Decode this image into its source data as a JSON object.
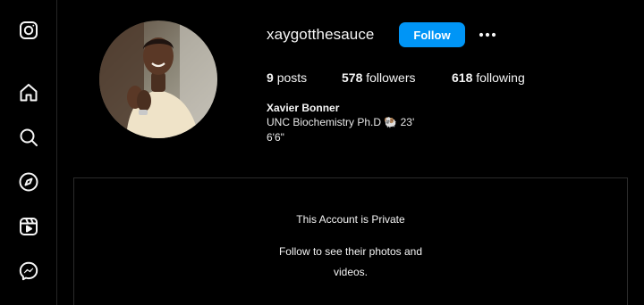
{
  "nav": {
    "items": [
      {
        "icon": "instagram-logo-icon"
      },
      {
        "icon": "home-icon"
      },
      {
        "icon": "search-icon"
      },
      {
        "icon": "explore-compass-icon"
      },
      {
        "icon": "reels-icon"
      },
      {
        "icon": "messenger-icon"
      }
    ]
  },
  "profile": {
    "username": "xaygotthesauce",
    "follow_label": "Follow",
    "more_icon": "more-options-icon",
    "stats": {
      "posts_count": "9",
      "posts_label": "posts",
      "followers_count": "578",
      "followers_label": "followers",
      "following_count": "618",
      "following_label": "following"
    },
    "full_name": "Xavier Bonner",
    "bio_line1": "UNC Biochemistry Ph.D 🐏 23'",
    "bio_line2": "6'6\""
  },
  "private": {
    "title": "This Account is Private",
    "subtitle": "Follow to see their photos and videos."
  },
  "colors": {
    "background": "#000000",
    "follow_button": "#0095f6",
    "divider": "#262626",
    "text": "#f5f5f5"
  }
}
